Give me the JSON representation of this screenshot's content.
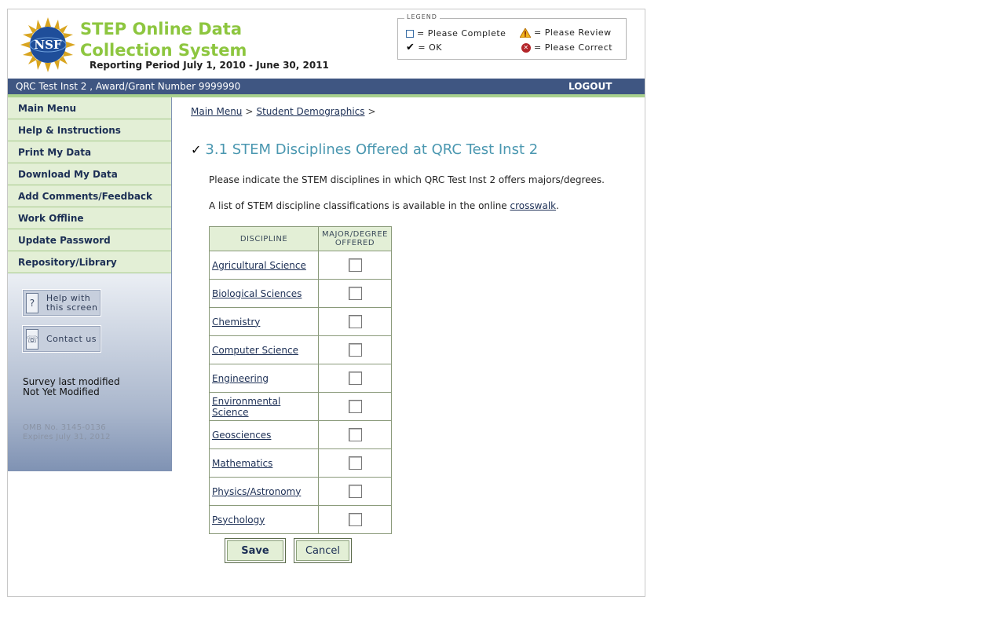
{
  "header": {
    "logo_text": "NSF",
    "title": "STEP Online Data Collection System",
    "reporting_period": "Reporting Period July 1, 2010 - June 30, 2011"
  },
  "legend": {
    "title": "LEGEND",
    "please_complete": "= Please Complete",
    "please_review": "= Please Review",
    "ok": "= OK",
    "please_correct": "= Please Correct"
  },
  "topbar": {
    "institution": "QRC Test Inst 2 , Award/Grant Number 9999990",
    "logout": "LOGOUT"
  },
  "sidebar": {
    "items": [
      {
        "label": "Main Menu"
      },
      {
        "label": "Help & Instructions"
      },
      {
        "label": "Print My Data"
      },
      {
        "label": "Download My Data"
      },
      {
        "label": "Add Comments/Feedback"
      },
      {
        "label": "Work Offline"
      },
      {
        "label": "Update Password"
      },
      {
        "label": "Repository/Library"
      }
    ],
    "help_button": "Help with this screen",
    "contact_button": "Contact us",
    "survey_label": "Survey last modified",
    "survey_value": "Not Yet Modified",
    "omb_number": "OMB No. 3145-0136",
    "omb_expires": "Expires July 31, 2012"
  },
  "breadcrumb": {
    "main_menu": "Main Menu",
    "student_demographics": "Student Demographics",
    "separator": ">"
  },
  "main": {
    "check_mark": "✓",
    "heading": "3.1 STEM Disciplines Offered at QRC Test Inst 2",
    "instruction": "Please indicate the STEM disciplines in which QRC Test Inst 2 offers majors/degrees.",
    "crosswalk_prefix": "A list of STEM discipline classifications is available in the online",
    "crosswalk_link": "crosswalk",
    "crosswalk_suffix": "."
  },
  "table": {
    "col_discipline": "DISCIPLINE",
    "col_offered": "MAJOR/DEGREE OFFERED",
    "rows": [
      {
        "name": "Agricultural Science",
        "checked": false
      },
      {
        "name": "Biological Sciences",
        "checked": false
      },
      {
        "name": "Chemistry",
        "checked": false
      },
      {
        "name": "Computer Science",
        "checked": false
      },
      {
        "name": "Engineering",
        "checked": false
      },
      {
        "name": "Environmental Science",
        "checked": false
      },
      {
        "name": "Geosciences",
        "checked": false
      },
      {
        "name": "Mathematics",
        "checked": false
      },
      {
        "name": "Physics/Astronomy",
        "checked": false
      },
      {
        "name": "Psychology",
        "checked": false
      }
    ]
  },
  "buttons": {
    "save": "Save",
    "cancel": "Cancel"
  },
  "colors": {
    "title_green": "#8dc63f",
    "nav_blue": "#3f5682",
    "heading_teal": "#4a97b0",
    "menu_green": "#e3efd6"
  }
}
